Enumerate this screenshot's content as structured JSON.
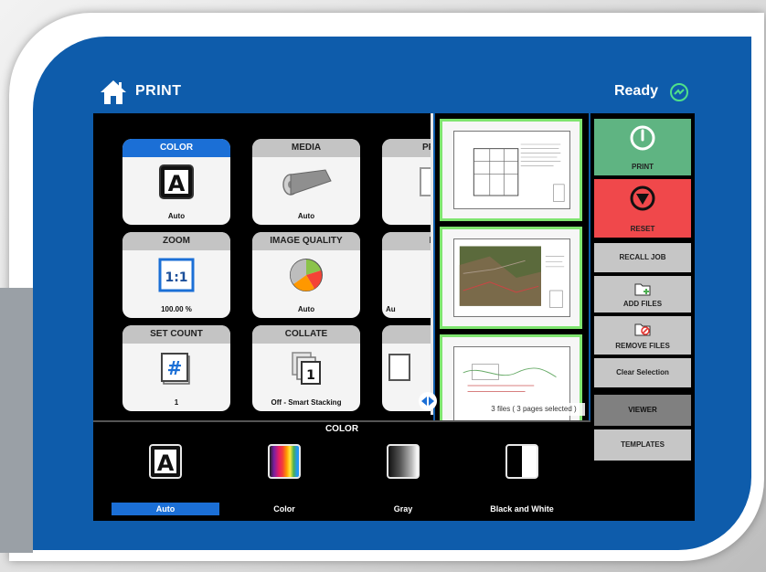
{
  "header": {
    "title": "PRINT",
    "status": "Ready"
  },
  "tiles": [
    {
      "label": "COLOR",
      "value": "Auto",
      "active": true
    },
    {
      "label": "MEDIA",
      "value": "Auto"
    },
    {
      "label": "PRINT",
      "value": ""
    },
    {
      "label": "ZOOM",
      "value": "100.00 %",
      "badge": "1:1"
    },
    {
      "label": "IMAGE QUALITY",
      "value": "Auto"
    },
    {
      "label": "RO",
      "value": "Au"
    },
    {
      "label": "SET COUNT",
      "value": "1"
    },
    {
      "label": "COLLATE",
      "value": "Off - Smart Stacking",
      "badge": "1"
    },
    {
      "label": "M",
      "value": ""
    }
  ],
  "preview": {
    "files_info": "3 files ( 3 pages selected )"
  },
  "actions": {
    "print": "PRINT",
    "reset": "RESET",
    "recall_job": "RECALL JOB",
    "add_files": "ADD FILES",
    "remove_files": "REMOVE FILES",
    "clear_selection": "Clear Selection",
    "viewer": "VIEWER",
    "templates": "TEMPLATES"
  },
  "color_section": {
    "title": "COLOR",
    "options": [
      {
        "label": "Auto",
        "selected": true
      },
      {
        "label": "Color"
      },
      {
        "label": "Gray"
      },
      {
        "label": "Black and White"
      }
    ]
  },
  "colors": {
    "brand_blue": "#0e5cab",
    "accent_blue": "#1b6fd6",
    "print_green": "#5fb482",
    "reset_red": "#f0484b",
    "selection_green": "#7fe56f"
  }
}
